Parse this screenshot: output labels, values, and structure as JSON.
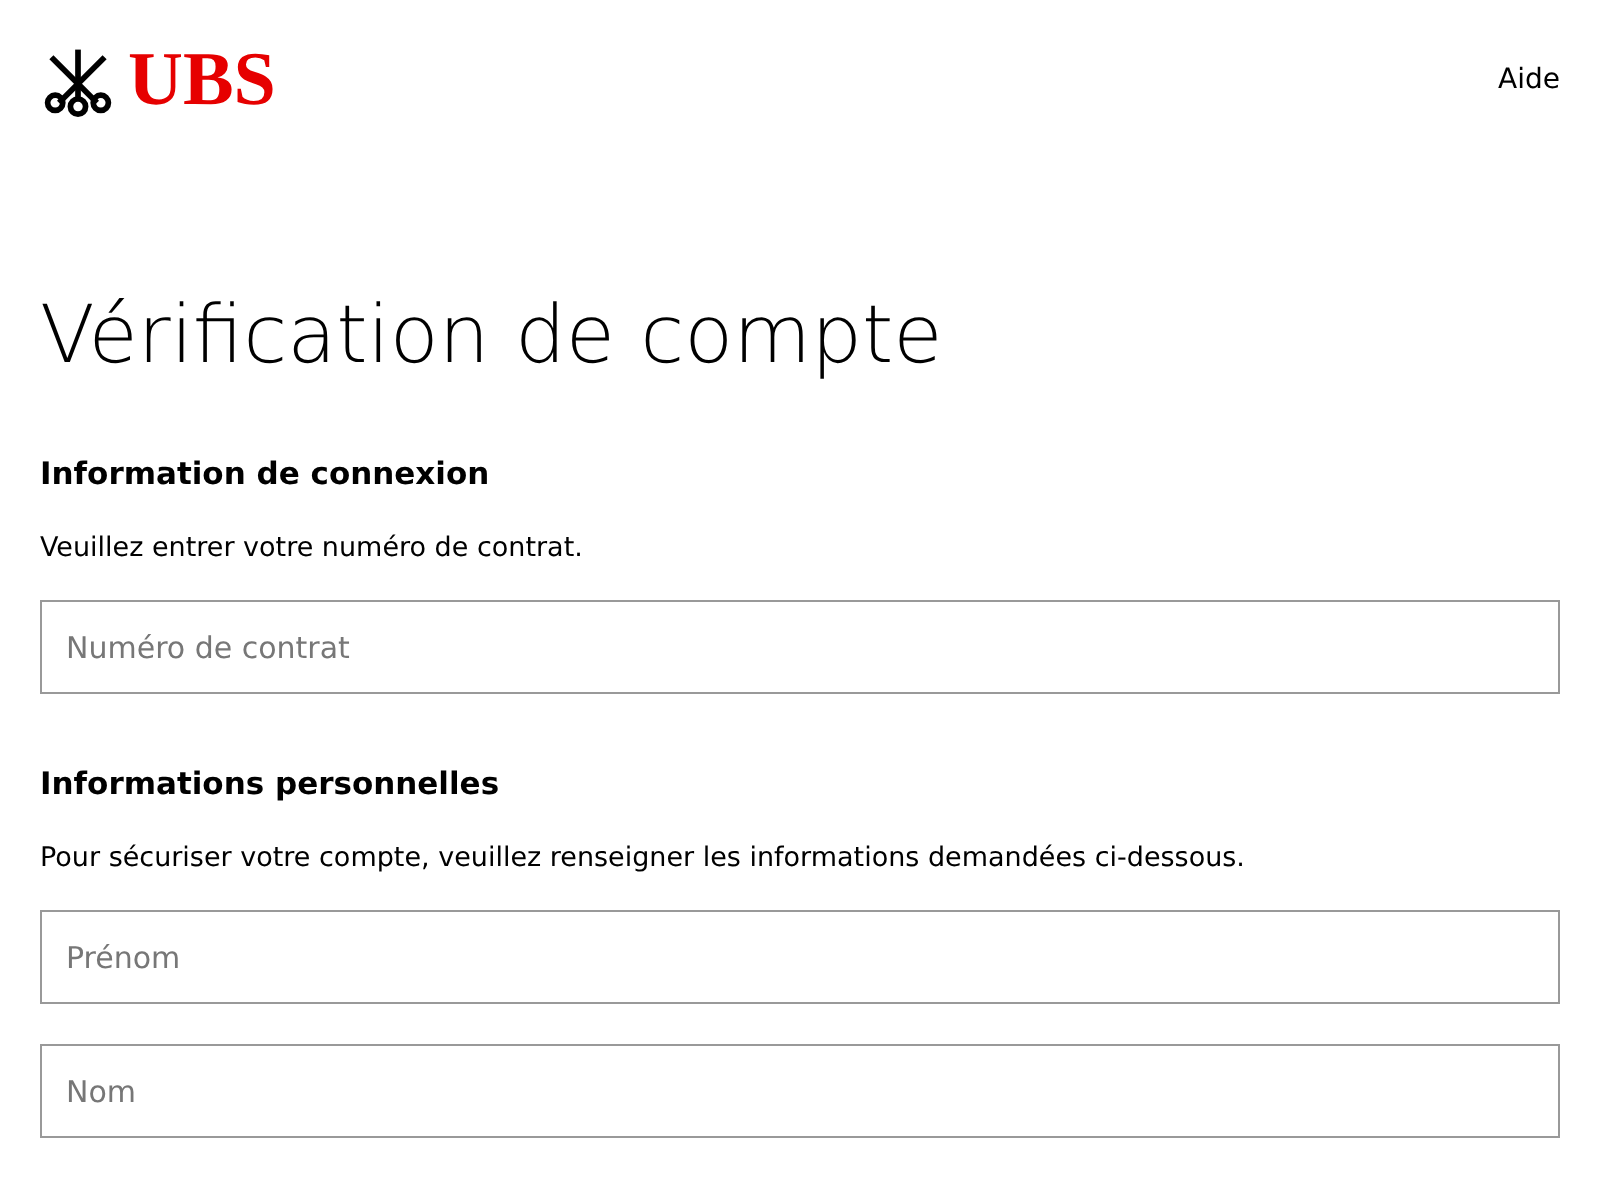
{
  "header": {
    "logo_text": "UBS",
    "help_link": "Aide"
  },
  "title": "Vérification de compte",
  "sections": [
    {
      "heading": "Information de connexion",
      "description": "Veuillez entrer votre numéro de contrat.",
      "fields": [
        {
          "placeholder": "Numéro de contrat"
        }
      ]
    },
    {
      "heading": "Informations personnelles",
      "description": "Pour sécuriser votre compte, veuillez renseigner les informations demandées ci-dessous.",
      "fields": [
        {
          "placeholder": "Prénom"
        },
        {
          "placeholder": "Nom"
        }
      ]
    }
  ]
}
